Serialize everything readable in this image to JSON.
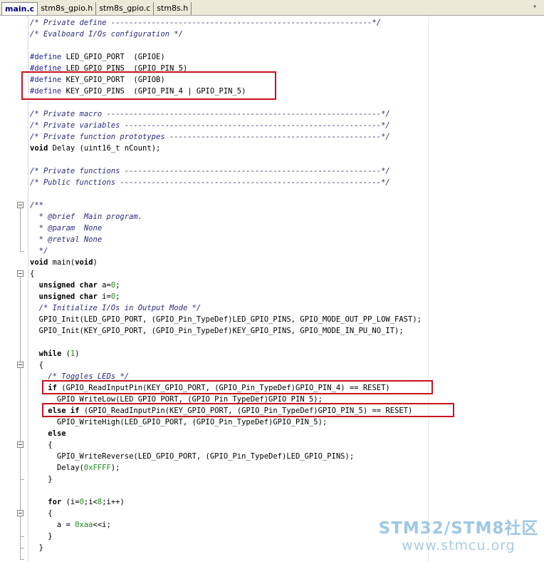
{
  "tabs": [
    {
      "label": "main.c",
      "active": true
    },
    {
      "label": "stm8s_gpio.h",
      "active": false
    },
    {
      "label": "stm8s_gpio.c",
      "active": false
    },
    {
      "label": "stm8s.h",
      "active": false
    }
  ],
  "colors": {
    "highlight_box": "#c8141e",
    "comment": "#2a2a82",
    "number": "#1e8c1e",
    "watermark": "#9ec8e6"
  },
  "code": [
    [
      {
        "t": "c",
        "s": "/* Private define ----------------------------------------------------------*/"
      }
    ],
    [
      {
        "t": "c",
        "s": "/* Evalboard I/Os configuration */"
      }
    ],
    [],
    [
      {
        "t": "p",
        "s": "#define"
      },
      {
        "t": "n",
        "s": " LED_GPIO_PORT  (GPIOE)"
      }
    ],
    [
      {
        "t": "p",
        "s": "#define"
      },
      {
        "t": "n",
        "s": " LED_GPIO_PINS  (GPIO_PIN_5)"
      }
    ],
    [
      {
        "t": "p",
        "s": "#define"
      },
      {
        "t": "n",
        "s": " KEY_GPIO_PORT  (GPIOB)"
      }
    ],
    [
      {
        "t": "p",
        "s": "#define"
      },
      {
        "t": "n",
        "s": " KEY_GPIO_PINS  (GPIO_PIN_4 | GPIO_PIN_5)"
      }
    ],
    [],
    [
      {
        "t": "c",
        "s": "/* Private macro -------------------------------------------------------------*/"
      }
    ],
    [
      {
        "t": "c",
        "s": "/* Private variables ---------------------------------------------------------*/"
      }
    ],
    [
      {
        "t": "c",
        "s": "/* Private function prototypes -----------------------------------------------*/"
      }
    ],
    [
      {
        "t": "k",
        "s": "void"
      },
      {
        "t": "n",
        "s": " Delay (uint16_t nCount);"
      }
    ],
    [],
    [
      {
        "t": "c",
        "s": "/* Private functions ---------------------------------------------------------*/"
      }
    ],
    [
      {
        "t": "c",
        "s": "/* Public functions ----------------------------------------------------------*/"
      }
    ],
    [],
    [
      {
        "t": "c",
        "s": "/**"
      }
    ],
    [
      {
        "t": "c",
        "s": "  * @brief  Main program."
      }
    ],
    [
      {
        "t": "c",
        "s": "  * @param  None"
      }
    ],
    [
      {
        "t": "c",
        "s": "  * @retval None"
      }
    ],
    [
      {
        "t": "c",
        "s": "  */"
      }
    ],
    [
      {
        "t": "k",
        "s": "void"
      },
      {
        "t": "n",
        "s": " main("
      },
      {
        "t": "k",
        "s": "void"
      },
      {
        "t": "n",
        "s": ")"
      }
    ],
    [
      {
        "t": "n",
        "s": "{"
      }
    ],
    [
      {
        "t": "n",
        "s": "  "
      },
      {
        "t": "k",
        "s": "unsigned char"
      },
      {
        "t": "n",
        "s": " a="
      },
      {
        "t": "d",
        "s": "0"
      },
      {
        "t": "n",
        "s": ";"
      }
    ],
    [
      {
        "t": "n",
        "s": "  "
      },
      {
        "t": "k",
        "s": "unsigned char"
      },
      {
        "t": "n",
        "s": " i="
      },
      {
        "t": "d",
        "s": "0"
      },
      {
        "t": "n",
        "s": ";"
      }
    ],
    [
      {
        "t": "n",
        "s": "  "
      },
      {
        "t": "c",
        "s": "/* Initialize I/Os in Output Mode */"
      }
    ],
    [
      {
        "t": "n",
        "s": "  GPIO_Init(LED_GPIO_PORT, (GPIO_Pin_TypeDef)LED_GPIO_PINS, GPIO_MODE_OUT_PP_LOW_FAST);"
      }
    ],
    [
      {
        "t": "n",
        "s": "  GPIO_Init(KEY_GPIO_PORT, (GPIO_Pin_TypeDef)KEY_GPIO_PINS, GPIO_MODE_IN_PU_NO_IT);"
      }
    ],
    [],
    [
      {
        "t": "n",
        "s": "  "
      },
      {
        "t": "k",
        "s": "while"
      },
      {
        "t": "n",
        "s": " ("
      },
      {
        "t": "d",
        "s": "1"
      },
      {
        "t": "n",
        "s": ")"
      }
    ],
    [
      {
        "t": "n",
        "s": "  {"
      }
    ],
    [
      {
        "t": "n",
        "s": "    "
      },
      {
        "t": "c",
        "s": "/* Toggles LEDs */"
      }
    ],
    [
      {
        "t": "n",
        "s": "    "
      },
      {
        "t": "k",
        "s": "if"
      },
      {
        "t": "n",
        "s": " (GPIO_ReadInputPin(KEY_GPIO_PORT, (GPIO_Pin_TypeDef)GPIO_PIN_4) == RESET)"
      }
    ],
    [
      {
        "t": "n",
        "s": "      GPIO_WriteLow(LED_GPIO_PORT, (GPIO_Pin_TypeDef)GPIO_PIN_5);"
      }
    ],
    [
      {
        "t": "n",
        "s": "    "
      },
      {
        "t": "k",
        "s": "else if"
      },
      {
        "t": "n",
        "s": " (GPIO_ReadInputPin(KEY_GPIO_PORT, (GPIO_Pin_TypeDef)GPIO_PIN_5) == RESET)"
      }
    ],
    [
      {
        "t": "n",
        "s": "      GPIO_WriteHigh(LED_GPIO_PORT, (GPIO_Pin_TypeDef)GPIO_PIN_5);"
      }
    ],
    [
      {
        "t": "n",
        "s": "    "
      },
      {
        "t": "k",
        "s": "else"
      }
    ],
    [
      {
        "t": "n",
        "s": "    {"
      }
    ],
    [
      {
        "t": "n",
        "s": "      GPIO_WriteReverse(LED_GPIO_PORT, (GPIO_Pin_TypeDef)LED_GPIO_PINS);"
      }
    ],
    [
      {
        "t": "n",
        "s": "      Delay("
      },
      {
        "t": "d",
        "s": "0xFFFF"
      },
      {
        "t": "n",
        "s": ");"
      }
    ],
    [
      {
        "t": "n",
        "s": "    }"
      }
    ],
    [],
    [
      {
        "t": "n",
        "s": "    "
      },
      {
        "t": "k",
        "s": "for"
      },
      {
        "t": "n",
        "s": " (i="
      },
      {
        "t": "d",
        "s": "0"
      },
      {
        "t": "n",
        "s": ";i<"
      },
      {
        "t": "d",
        "s": "8"
      },
      {
        "t": "n",
        "s": ";i++)"
      }
    ],
    [
      {
        "t": "n",
        "s": "    {"
      }
    ],
    [
      {
        "t": "n",
        "s": "      a = "
      },
      {
        "t": "d",
        "s": "0xaa"
      },
      {
        "t": "n",
        "s": "<<i;"
      }
    ],
    [
      {
        "t": "n",
        "s": "    }"
      }
    ],
    [
      {
        "t": "n",
        "s": "  }"
      }
    ]
  ],
  "watermark": {
    "title": "STM32/STM8社区",
    "url": "www.stmcu.org"
  }
}
